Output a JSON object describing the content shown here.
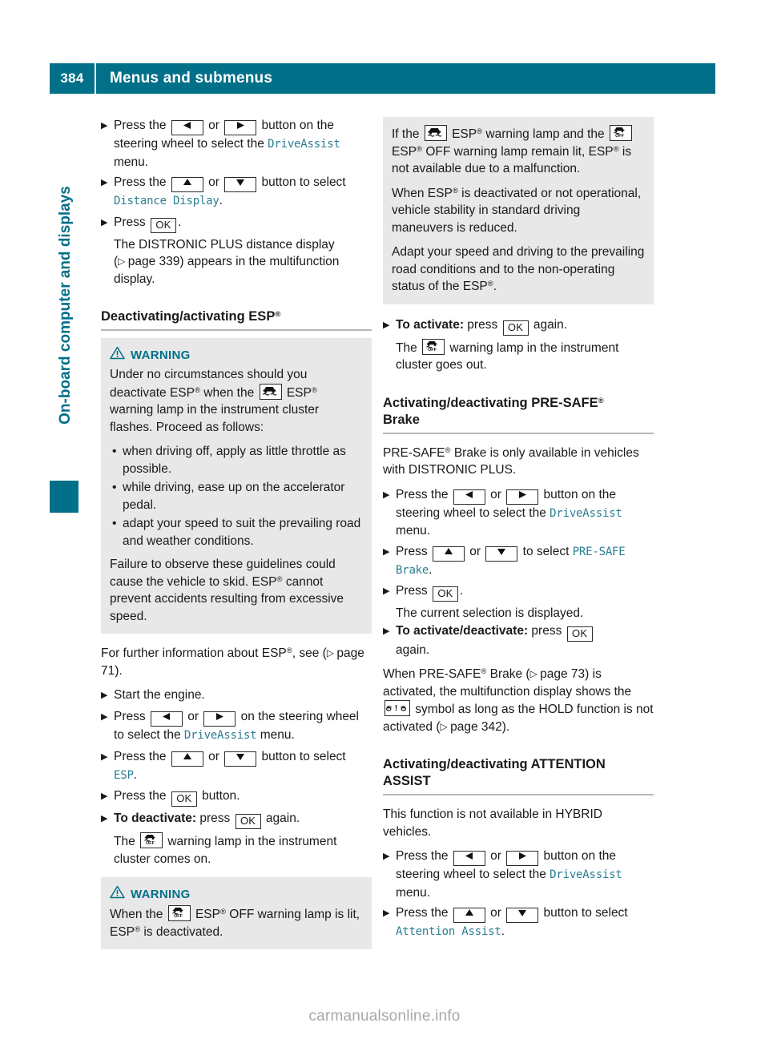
{
  "header": {
    "page_number": "384",
    "title": "Menus and submenus"
  },
  "sidebar": {
    "label": "On-board computer and displays"
  },
  "footer": {
    "watermark": "carmanualsonline.info"
  },
  "keys": {
    "left": "◀",
    "right": "▶",
    "up": "▲",
    "down": "▼",
    "ok": "OK"
  },
  "left_column": {
    "step1": {
      "t1": "Press the ",
      "t2": " or ",
      "t3": " button on the steering wheel to select the ",
      "menu": "DriveAssist",
      "t4": " menu."
    },
    "step2": {
      "t1": "Press the ",
      "t2": " or ",
      "t3": " button to select ",
      "menu": "Distance Display",
      "t4": "."
    },
    "step3": {
      "t1": "Press ",
      "t2": ".",
      "cont1": "The DISTRONIC PLUS distance display (",
      "page_ref": "page 339",
      "cont2": ") appears in the multifunction display."
    },
    "heading_esp": "Deactivating/activating ESP",
    "warning1": {
      "label": "WARNING",
      "p1a": "Under no circumstances should you deactivate ESP",
      "p1b": " when the ",
      "p1c": " ESP",
      "p1d": " warning lamp in the instrument cluster flashes. Proceed as follows:",
      "bullets": [
        "when driving off, apply as little throttle as possible.",
        "while driving, ease up on the accelerator pedal.",
        "adapt your speed to suit the prevailing road and weather conditions."
      ],
      "p2a": "Failure to observe these guidelines could cause the vehicle to skid. ESP",
      "p2b": " cannot prevent accidents resulting from excessive speed."
    },
    "further_info": {
      "t1": "For further information about ESP",
      "t2": ", see (",
      "page_ref": "page 71",
      "t3": ")."
    },
    "step4": "Start the engine.",
    "step5": {
      "t1": "Press ",
      "t2": " or ",
      "t3": " on the steering wheel to select the ",
      "menu": "DriveAssist",
      "t4": " menu."
    },
    "step6": {
      "t1": "Press the ",
      "t2": " or ",
      "t3": " button to select ",
      "menu": "ESP",
      "t4": "."
    },
    "step7": {
      "t1": "Press the ",
      "t2": " button."
    },
    "step8": {
      "bold": "To deactivate:",
      "t1": " press ",
      "t2": " again.",
      "cont1": "The ",
      "cont2": " warning lamp in the instrument cluster comes on."
    },
    "warning2": {
      "label": "WARNING",
      "p1a": "When the ",
      "p1b": " ESP",
      "p1c": " OFF warning lamp is lit, ESP",
      "p1d": " is deactivated."
    }
  },
  "right_column": {
    "note_box": {
      "p1a": "If the ",
      "p1b": " ESP",
      "p1c": " warning lamp and the ",
      "p1d": " ESP",
      "p1e": " OFF warning lamp remain lit, ESP",
      "p1f": " is not available due to a malfunction.",
      "p2a": "When ESP",
      "p2b": " is deactivated or not operational, vehicle stability in standard driving maneuvers is reduced.",
      "p3a": "Adapt your speed and driving to the prevailing road conditions and to the non-operating status of the ESP",
      "p3b": "."
    },
    "step_activate": {
      "bold": "To activate:",
      "t1": " press ",
      "t2": " again.",
      "cont1": "The ",
      "cont2": " warning lamp in the instrument cluster goes out."
    },
    "heading_presafe": "Activating/deactivating PRE-SAFE",
    "heading_presafe_line2": "Brake",
    "presafe_intro": {
      "t1": "PRE-SAFE",
      "t2": " Brake is only available in vehicles with DISTRONIC PLUS."
    },
    "ps_step1": {
      "t1": "Press the ",
      "t2": " or ",
      "t3": " button on the steering wheel to select the ",
      "menu": "DriveAssist",
      "t4": " menu."
    },
    "ps_step2": {
      "t1": "Press ",
      "t2": " or ",
      "t3": " to select ",
      "menu": "PRE-SAFE",
      "menu2": "Brake",
      "t4": "."
    },
    "ps_step3": {
      "t1": "Press ",
      "t2": ".",
      "cont": "The current selection is displayed."
    },
    "ps_step4": {
      "bold": "To activate/deactivate:",
      "t1": " press ",
      "t2": "again."
    },
    "ps_note": {
      "t1": "When PRE-SAFE",
      "t2": " Brake (",
      "page_ref1": "page 73",
      "t3": ") is activated, the multifunction display shows the ",
      "t4": " symbol as long as the HOLD function is not activated (",
      "page_ref2": "page 342",
      "t5": ")."
    },
    "heading_attention": "Activating/deactivating ATTENTION",
    "heading_attention_line2": "ASSIST",
    "attention_intro": "This function is not available in HYBRID vehicles.",
    "att_step1": {
      "t1": "Press the ",
      "t2": " or ",
      "t3": " button on the steering wheel to select the ",
      "menu": "DriveAssist",
      "t4": " menu."
    },
    "att_step2": {
      "t1": "Press the ",
      "t2": " or ",
      "t3": " button to select ",
      "menu": "Attention Assist",
      "t4": "."
    }
  },
  "colors": {
    "brand_teal": "#027089",
    "menu_teal": "#2b7d92",
    "grey_box": "#e8e8e8",
    "rule_grey": "#b7b7b7"
  }
}
